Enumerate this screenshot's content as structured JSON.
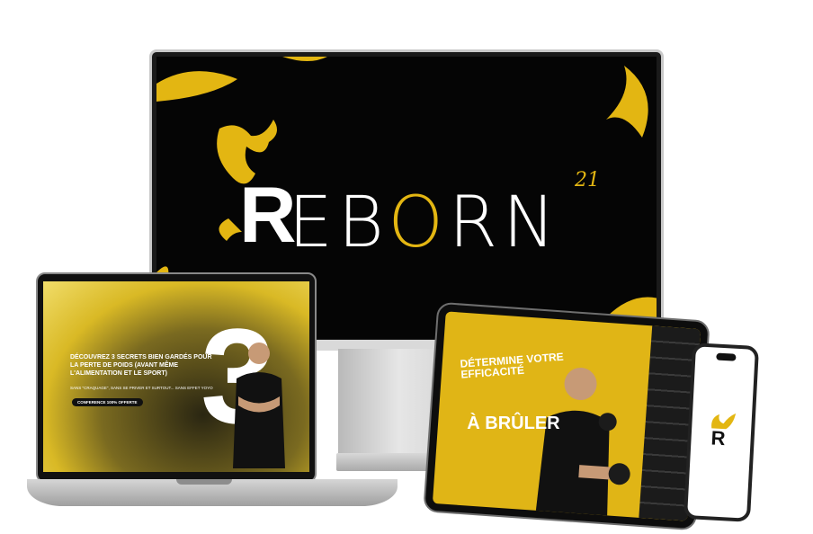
{
  "monitor": {
    "logo_lead": "R",
    "logo_rest_1": "EB",
    "logo_o": "O",
    "logo_rest_2": "RN",
    "logo_superscript": "21"
  },
  "laptop": {
    "headline": "DÉCOUVREZ 3 SECRETS BIEN GARDÉS POUR LA PERTE DE POIDS (AVANT MÊME L'ALIMENTATION ET LE SPORT)",
    "subline": "SANS \"CRAQUAGE\", SANS SE PRIVER ET SURTOUT... SANS EFFET YOYO",
    "button": "CONFERENCE 100% OFFERTE",
    "big_number": "3"
  },
  "tablet": {
    "headline": "DÉTERMINE VOTRE EFFICACITÉ",
    "subheadline": "À BRÛLER"
  },
  "phone": {
    "logo_letter": "R"
  },
  "colors": {
    "brand_yellow": "#e3b612",
    "background": "#ffffff",
    "screen_black": "#050505"
  }
}
